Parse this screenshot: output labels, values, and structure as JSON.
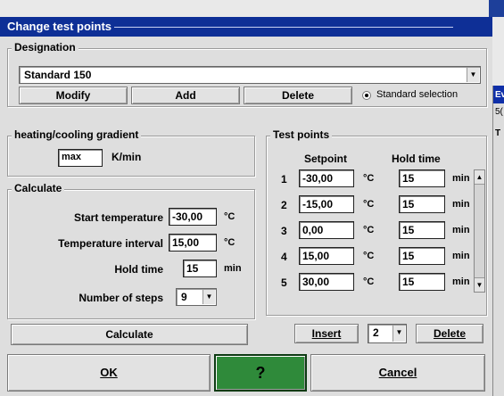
{
  "window_title": "Change test points",
  "designation": {
    "legend": "Designation",
    "selected": "Standard 150",
    "buttons": {
      "modify": "Modify",
      "add": "Add",
      "delete": "Delete"
    },
    "standard_selection_label": "Standard selection"
  },
  "gradient": {
    "legend": "heating/cooling gradient",
    "value": "max",
    "unit": "K/min"
  },
  "calculate": {
    "legend": "Calculate",
    "start_temperature": {
      "label": "Start temperature",
      "value": "-30,00",
      "unit": "°C"
    },
    "temperature_interval": {
      "label": "Temperature interval",
      "value": "15,00",
      "unit": "°C"
    },
    "hold_time": {
      "label": "Hold time",
      "value": "15",
      "unit": "min"
    },
    "number_of_steps": {
      "label": "Number of steps",
      "value": "9"
    },
    "button": "Calculate"
  },
  "test_points": {
    "legend": "Test points",
    "headers": {
      "setpoint": "Setpoint",
      "hold_time": "Hold time"
    },
    "temp_unit": "°C",
    "time_unit": "min",
    "rows": [
      {
        "n": "1",
        "setpoint": "-30,00",
        "hold": "15"
      },
      {
        "n": "2",
        "setpoint": "-15,00",
        "hold": "15"
      },
      {
        "n": "3",
        "setpoint": "0,00",
        "hold": "15"
      },
      {
        "n": "4",
        "setpoint": "15,00",
        "hold": "15"
      },
      {
        "n": "5",
        "setpoint": "30,00",
        "hold": "15"
      }
    ],
    "insert_button": "Insert",
    "position_select": "2",
    "delete_button": "Delete"
  },
  "footer": {
    "ok": "OK",
    "help": "?",
    "cancel": "Cancel"
  },
  "background_window": {
    "title": "Ev",
    "line1": "5(",
    "line2": "T"
  },
  "colors": {
    "titlebar": "#0e2f96",
    "help_button": "#2f8a3a"
  }
}
